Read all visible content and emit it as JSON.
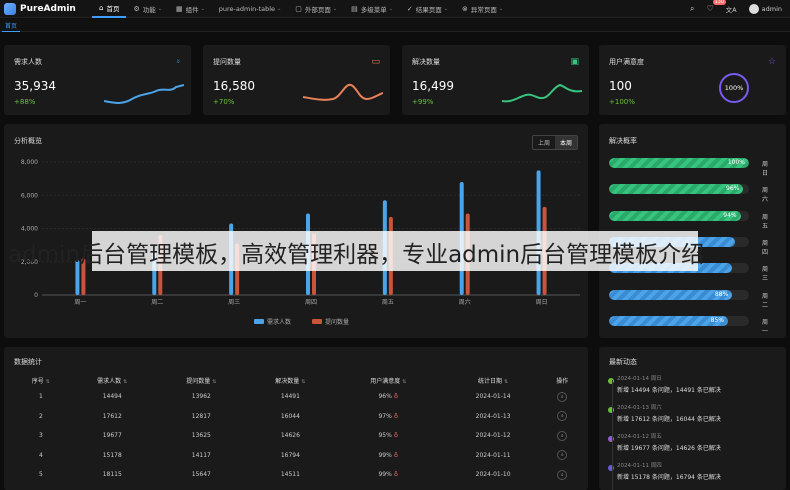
{
  "app": {
    "name": "PureAdmin"
  },
  "nav": [
    {
      "icon": "⌂",
      "label": "首页",
      "dropdown": false,
      "active": true
    },
    {
      "icon": "⚙",
      "label": "功能",
      "dropdown": true
    },
    {
      "icon": "▦",
      "label": "组件",
      "dropdown": true
    },
    {
      "icon": "",
      "label": "pure-admin-table",
      "dropdown": true
    },
    {
      "icon": "▢",
      "label": "外部页面",
      "dropdown": true
    },
    {
      "icon": "▤",
      "label": "多级菜单",
      "dropdown": true
    },
    {
      "icon": "✓",
      "label": "结果页面",
      "dropdown": true
    },
    {
      "icon": "⊗",
      "label": "异常页面",
      "dropdown": true
    }
  ],
  "topright": {
    "search_icon": "⌕",
    "bell_icon": "🔔",
    "badge": "130",
    "translate_icon": "文A",
    "user": "admin"
  },
  "tags": {
    "current": "首页"
  },
  "stats": [
    {
      "title": "需求人数",
      "value": "35,934",
      "pct": "+88%",
      "icon": "person-icon",
      "color": "#4ba3ea"
    },
    {
      "title": "提问数量",
      "value": "16,580",
      "pct": "+70%",
      "icon": "message-icon",
      "color": "#e8805a"
    },
    {
      "title": "解决数量",
      "value": "16,499",
      "pct": "+99%",
      "icon": "chat-check-icon",
      "color": "#37c47f"
    },
    {
      "title": "用户满意度",
      "value": "100",
      "pct": "+100%",
      "icon": "star-icon",
      "color": "#7a5af0",
      "ring": "100%"
    }
  ],
  "overview": {
    "title": "分析概览",
    "toggle": [
      "上周",
      "本周"
    ],
    "toggle_active": 1
  },
  "chart_data": {
    "type": "bar",
    "categories": [
      "周一",
      "周二",
      "周三",
      "周四",
      "周五",
      "周六",
      "周日"
    ],
    "series": [
      {
        "name": "需求人数",
        "color": "#4ba3ea",
        "values": [
          2100,
          2700,
          4300,
          4900,
          5700,
          6800,
          7500
        ]
      },
      {
        "name": "提问数量",
        "color": "#c8553a",
        "values": [
          2200,
          3600,
          3100,
          3700,
          4700,
          4900,
          5300
        ]
      }
    ],
    "y_ticks": [
      "8,000",
      "6,000",
      "4,000",
      "2,000",
      "0"
    ],
    "ylim": [
      0,
      8000
    ],
    "grid": true,
    "legend": "bottom"
  },
  "rates": {
    "title": "解决概率",
    "rows": [
      {
        "pct": "100%",
        "fill": 1.0,
        "day": "周日",
        "color": "g"
      },
      {
        "pct": "96%",
        "fill": 0.96,
        "day": "周六",
        "color": "g"
      },
      {
        "pct": "94%",
        "fill": 0.94,
        "day": "周五",
        "color": "g"
      },
      {
        "pct": "",
        "fill": 0.9,
        "day": "周四",
        "color": "b"
      },
      {
        "pct": "",
        "fill": 0.88,
        "day": "周三",
        "color": "b"
      },
      {
        "pct": "88%",
        "fill": 0.88,
        "day": "周二",
        "color": "b"
      },
      {
        "pct": "85%",
        "fill": 0.85,
        "day": "周一",
        "color": "b"
      }
    ]
  },
  "table": {
    "title": "数据统计",
    "headers": [
      "序号",
      "需求人数",
      "提问数量",
      "解决数量",
      "用户满意度",
      "统计日期",
      "操作"
    ],
    "rows": [
      [
        "1",
        "14494",
        "13962",
        "14491",
        "96%",
        "2024-01-14"
      ],
      [
        "2",
        "17612",
        "12817",
        "16044",
        "97%",
        "2024-01-13"
      ],
      [
        "3",
        "19677",
        "13625",
        "14626",
        "95%",
        "2024-01-12"
      ],
      [
        "4",
        "15178",
        "14117",
        "16794",
        "99%",
        "2024-01-11"
      ],
      [
        "5",
        "18115",
        "15647",
        "14511",
        "99%",
        "2024-01-10"
      ]
    ]
  },
  "news": {
    "title": "最新动态",
    "items": [
      {
        "date": "2024-01-14 周日",
        "text": "新增 14494 条问题，14491 条已解决",
        "color": "#67c23a"
      },
      {
        "date": "2024-01-13 周六",
        "text": "新增 17612 条问题，16044 条已解决",
        "color": "#67c23a"
      },
      {
        "date": "2024-01-12 周五",
        "text": "新增 19677 条问题，14626 条已解决",
        "color": "#9c5bd6"
      },
      {
        "date": "2024-01-11 周四",
        "text": "新增 15178 条问题，16794 条已解决",
        "color": "#6a5bd6"
      }
    ]
  },
  "watermark": {
    "text": "admin后台管理模板，高效管理利器，专业admin后台管理模板介绍"
  }
}
